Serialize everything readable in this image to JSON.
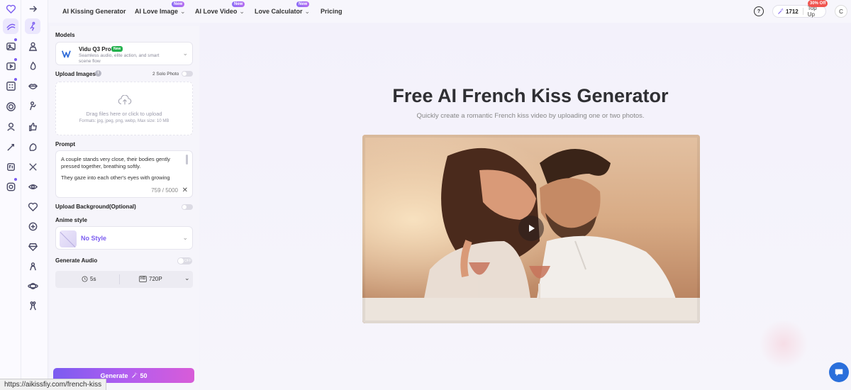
{
  "nav": {
    "items": [
      {
        "label": "AI Kissing Generator",
        "dropdown": false,
        "badge": ""
      },
      {
        "label": "AI Love Image",
        "dropdown": true,
        "badge": "New"
      },
      {
        "label": "AI Love Video",
        "dropdown": true,
        "badge": "New"
      },
      {
        "label": "Love Calculator",
        "dropdown": true,
        "badge": "New"
      },
      {
        "label": "Pricing",
        "dropdown": false,
        "badge": ""
      }
    ],
    "credits": "1712",
    "top_up_label": "Top Up",
    "discount_badge": "30% Off",
    "avatar_initial": "C",
    "help_icon": "help-circle-icon"
  },
  "panel": {
    "models_label": "Models",
    "model": {
      "name": "Vidu Q3 Pro",
      "badge": "New",
      "description": "Seamless audio, elite action, and smart scene flow"
    },
    "upload_images_label": "Upload Images",
    "solo_photo_label": "2 Solo Photo",
    "upload_hint": "Drag files here or click to upload",
    "upload_formats": "Formats: jpg, jpeg, png, webp, Max size: 10 MB",
    "prompt_label": "Prompt",
    "prompt_text_1": "A couple stands very close, their bodies gently pressed together, breathing softly.",
    "prompt_text_2": "They gaze into each other's eyes with growing",
    "prompt_count": "759 / 5000",
    "upload_background_label": "Upload Background(Optional)",
    "anime_style_label": "Anime style",
    "anime_style_value": "No Style",
    "generate_audio_label": "Generate Audio",
    "audio_toggle_text": "OFF",
    "duration": "5s",
    "resolution_badge": "HD",
    "resolution": "720P",
    "generate_label": "Generate",
    "generate_cost": "50"
  },
  "main": {
    "title": "Free AI French Kiss Generator",
    "subtitle": "Quickly create a romantic French kiss video by uploading one or two photos."
  },
  "status_url": "https://aikissfiy.com/french-kiss",
  "colors": {
    "accent": "#7b5cf0",
    "generate_gradient_end": "#d85cd8",
    "discount": "#f0544f",
    "chat": "#2a6fdb"
  }
}
